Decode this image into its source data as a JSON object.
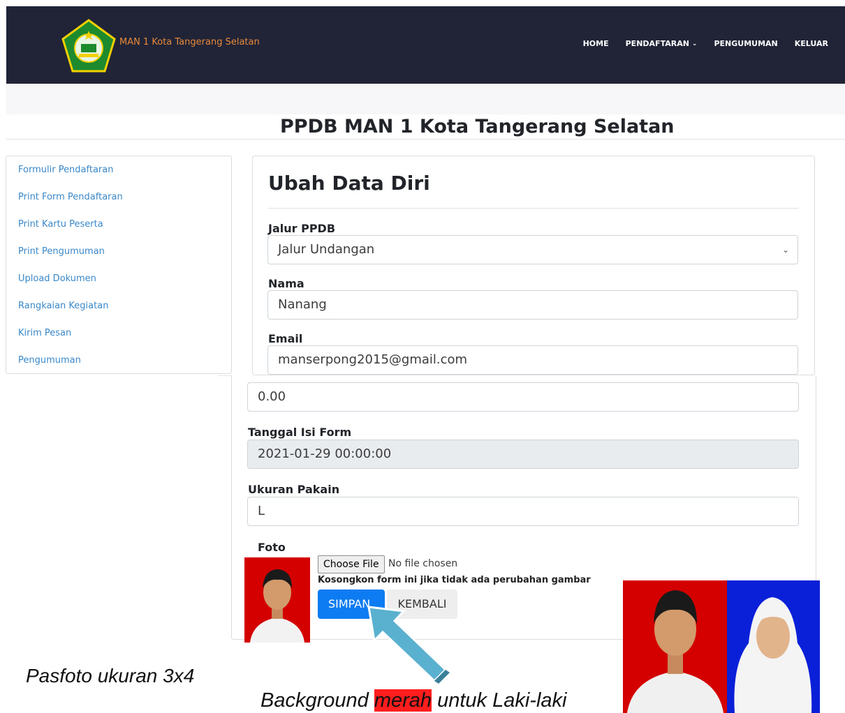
{
  "header": {
    "brand": "MAN 1 Kota Tangerang Selatan",
    "nav": {
      "home": "HOME",
      "pendaftaran": "PENDAFTARAN",
      "pengumuman": "PENGUMUMAN",
      "keluar": "KELUAR"
    }
  },
  "page_title": "PPDB MAN 1 Kota Tangerang Selatan",
  "sidebar": {
    "items": [
      {
        "label": "Formulir Pendaftaran"
      },
      {
        "label": "Print Form Pendaftaran"
      },
      {
        "label": "Print Kartu Peserta"
      },
      {
        "label": "Print Pengumuman"
      },
      {
        "label": "Upload Dokumen"
      },
      {
        "label": "Rangkaian Kegiatan"
      },
      {
        "label": "Kirim Pesan"
      },
      {
        "label": "Pengumuman"
      }
    ]
  },
  "form": {
    "title": "Ubah Data Diri",
    "jalur": {
      "label": "Jalur PPDB",
      "value": "Jalur Undangan"
    },
    "nama": {
      "label": "Nama",
      "value": "Nanang"
    },
    "email": {
      "label": "Email",
      "value": "manserpong2015@gmail.com"
    },
    "unlabeled_value": "0.00",
    "tanggal": {
      "label": "Tanggal Isi Form",
      "value": "2021-01-29 00:00:00"
    },
    "ukuran": {
      "label": "Ukuran Pakain",
      "value": "L"
    },
    "foto": {
      "label": "Foto",
      "choose": "Choose File",
      "nofile": "No file chosen",
      "hint": "Kosongkon form ini jika tidak ada perubahan gambar"
    },
    "save": "SIMPAN",
    "back": "KEMBALI"
  },
  "captions": {
    "size": "Pasfoto ukuran 3x4",
    "bg_prefix": "Background ",
    "bg_highlight": "merah",
    "bg_suffix": " untuk Laki-laki"
  },
  "colors": {
    "navbar": "#212436",
    "brand": "#e8893a",
    "link": "#3a88c8",
    "primary": "#0d7cf2",
    "photo_red": "#d40000",
    "photo_blue": "#0a1fd8",
    "arrow": "#5ab0cf"
  }
}
